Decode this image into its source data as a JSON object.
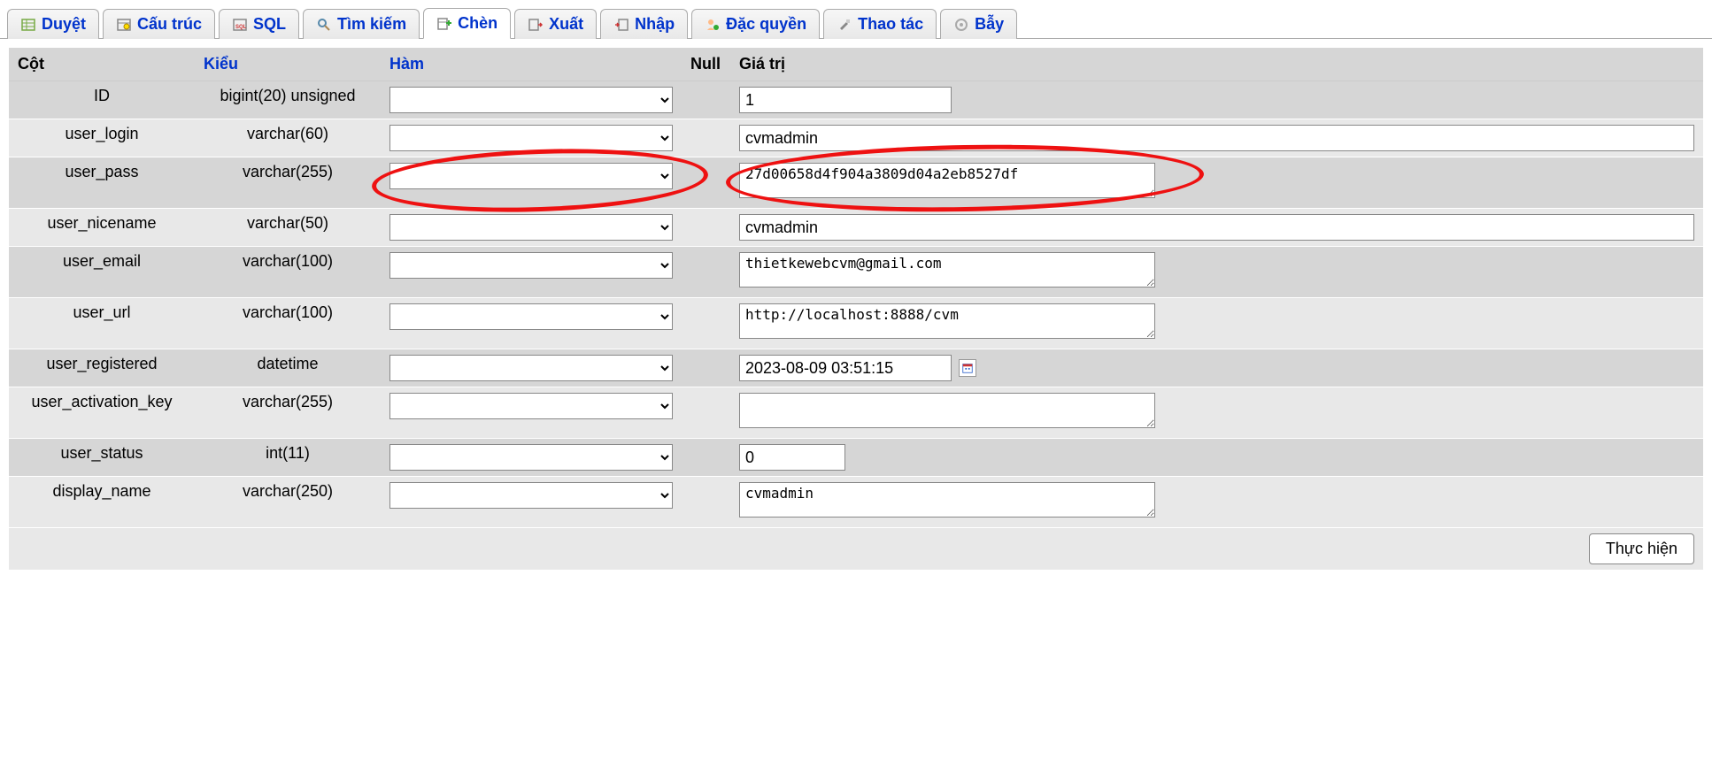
{
  "tabs": {
    "browse": "Duyệt",
    "structure": "Cấu trúc",
    "sql": "SQL",
    "search": "Tìm kiếm",
    "insert": "Chèn",
    "export": "Xuất",
    "import": "Nhập",
    "privileges": "Đặc quyền",
    "operations": "Thao tác",
    "triggers": "Bẫy"
  },
  "headers": {
    "column": "Cột",
    "type": "Kiểu",
    "function": "Hàm",
    "null": "Null",
    "value": "Giá trị"
  },
  "rows": [
    {
      "col": "ID",
      "type": "bigint(20) unsigned",
      "input": "short",
      "value": "1"
    },
    {
      "col": "user_login",
      "type": "varchar(60)",
      "input": "wide",
      "value": "cvmadmin"
    },
    {
      "col": "user_pass",
      "type": "varchar(255)",
      "input": "textarea",
      "value": "27d00658d4f904a3809d04a2eb8527df"
    },
    {
      "col": "user_nicename",
      "type": "varchar(50)",
      "input": "wide",
      "value": "cvmadmin"
    },
    {
      "col": "user_email",
      "type": "varchar(100)",
      "input": "textarea",
      "value": "thietkewebcvm@gmail.com"
    },
    {
      "col": "user_url",
      "type": "varchar(100)",
      "input": "textarea",
      "value": "http://localhost:8888/cvm"
    },
    {
      "col": "user_registered",
      "type": "datetime",
      "input": "datetime",
      "value": "2023-08-09 03:51:15"
    },
    {
      "col": "user_activation_key",
      "type": "varchar(255)",
      "input": "textarea",
      "value": ""
    },
    {
      "col": "user_status",
      "type": "int(11)",
      "input": "int",
      "value": "0"
    },
    {
      "col": "display_name",
      "type": "varchar(250)",
      "input": "textarea",
      "value": "cvmadmin"
    }
  ],
  "buttons": {
    "execute": "Thực hiện"
  }
}
